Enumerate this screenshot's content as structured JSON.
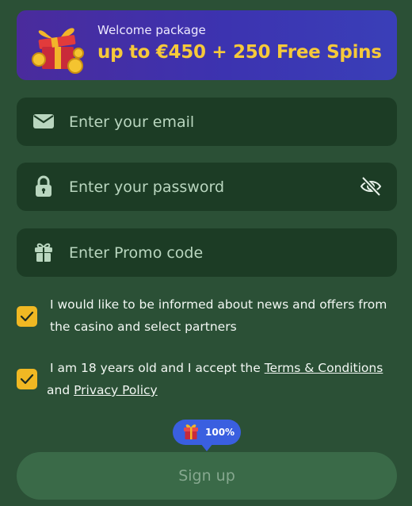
{
  "banner": {
    "kicker": "Welcome package",
    "headline": "up to €450 + 250 Free Spins",
    "icon": "gift-with-coins-icon"
  },
  "fields": {
    "email": {
      "placeholder": "Enter your email",
      "value": "",
      "icon": "envelope-icon"
    },
    "password": {
      "placeholder": "Enter your password",
      "value": "",
      "icon": "lock-icon",
      "toggle_icon": "eye-slash-icon"
    },
    "promo": {
      "placeholder": "Enter Promo code",
      "value": "",
      "icon": "gift-icon"
    }
  },
  "consents": {
    "news": {
      "checked": true,
      "text": "I would like to be informed about news and offers from the casino and select partners"
    },
    "age": {
      "checked": true,
      "text_before": "I am 18 years old and I accept the ",
      "terms_link": "Terms & Conditions",
      "text_middle": " and ",
      "privacy_link": "Privacy Policy"
    }
  },
  "bonus_badge": {
    "percent": "100%",
    "icon": "gift-icon"
  },
  "signup": {
    "label": "Sign up"
  },
  "colors": {
    "background": "#2b5036",
    "field": "#1c3c25",
    "accent_yellow": "#f0b823",
    "banner_purple": "#3c33b0",
    "badge_blue": "#3a5fe0",
    "button_disabled": "#3a6a48"
  }
}
